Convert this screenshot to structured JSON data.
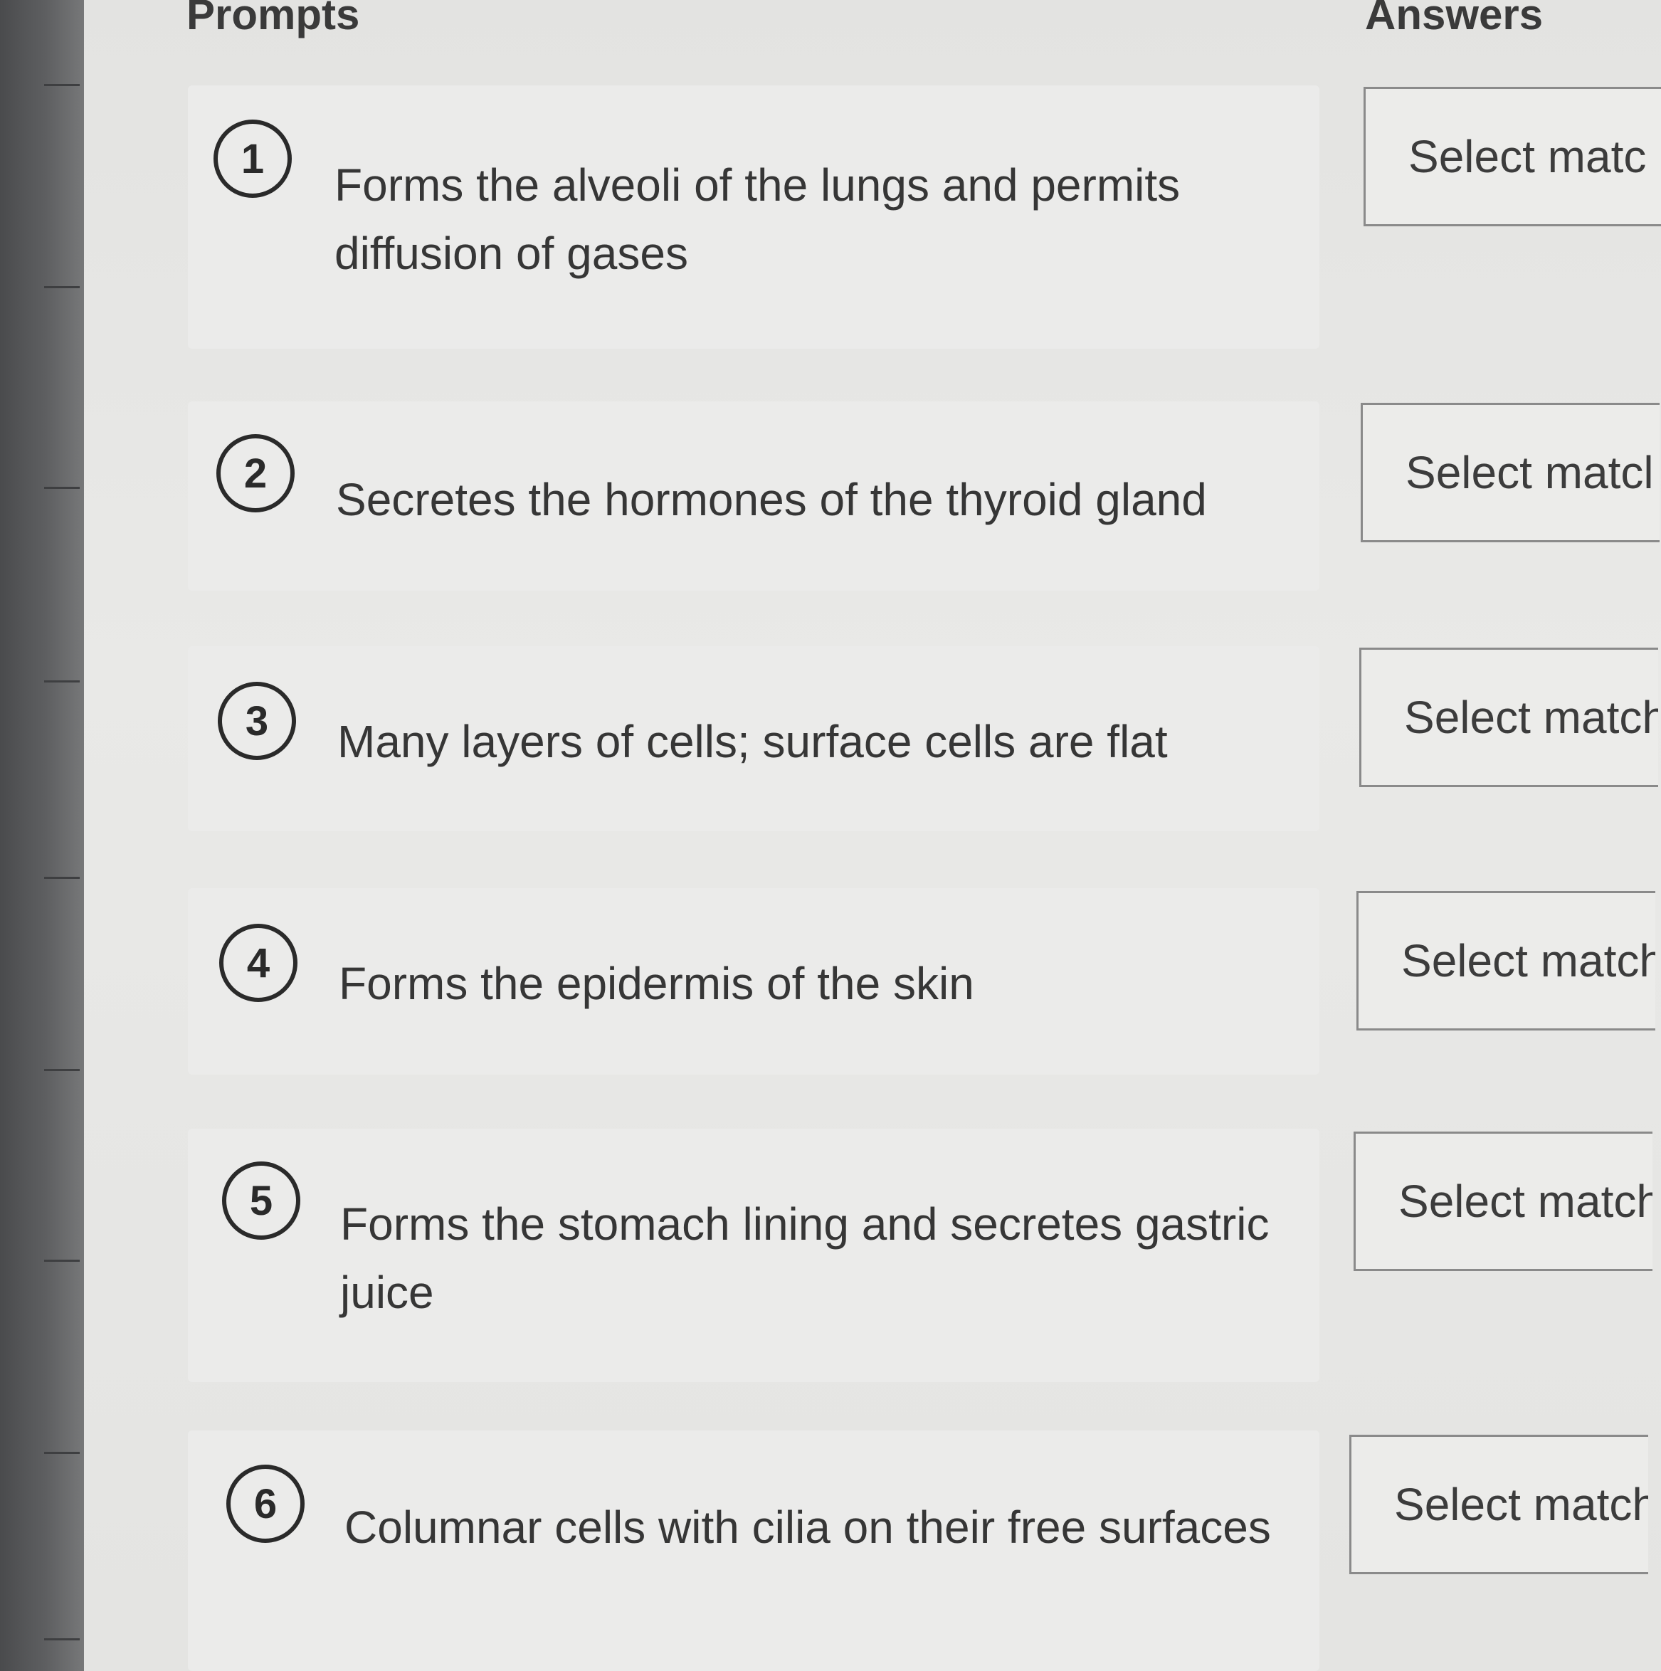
{
  "headings": {
    "prompts": "Prompts",
    "answers": "Answers"
  },
  "items": [
    {
      "number": "1",
      "prompt": "Forms the alveoli of the lungs and permits diffusion of gases",
      "answer": "Select matc"
    },
    {
      "number": "2",
      "prompt": "Secretes the hormones of the thyroid gland",
      "answer": "Select matcl"
    },
    {
      "number": "3",
      "prompt": "Many layers of cells; surface cells are flat",
      "answer": "Select match"
    },
    {
      "number": "4",
      "prompt": "Forms the epidermis of the skin",
      "answer": "Select match"
    },
    {
      "number": "5",
      "prompt": "Forms the stomach lining and secretes gastric juice",
      "answer": "Select match"
    },
    {
      "number": "6",
      "prompt": "Columnar cells with cilia on their free surfaces",
      "answer": "Select match"
    }
  ]
}
